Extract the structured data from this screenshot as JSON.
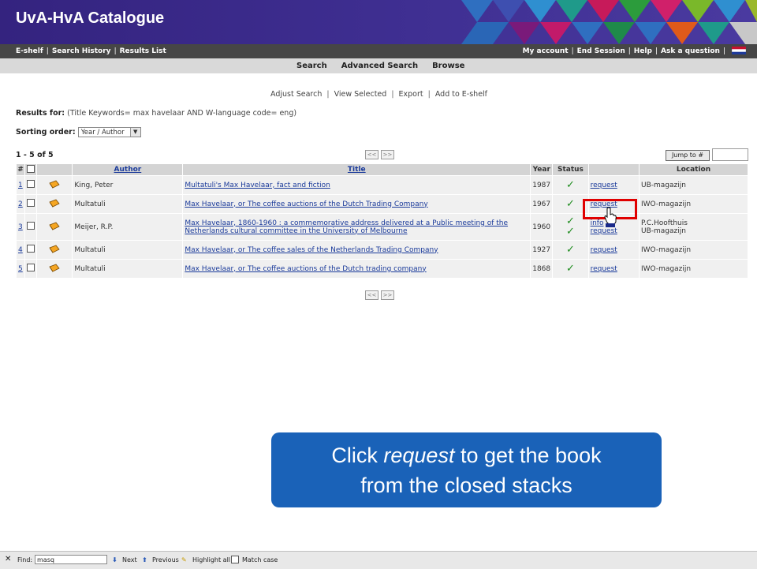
{
  "header": {
    "title": "UvA-HvA Catalogue"
  },
  "topbar": {
    "left": [
      "E-shelf",
      "Search History",
      "Results List"
    ],
    "right": [
      "My account",
      "End Session",
      "Help",
      "Ask a question"
    ],
    "separator": "|"
  },
  "mainnav": [
    "Search",
    "Advanced Search",
    "Browse"
  ],
  "actions": [
    "Adjust Search",
    "View Selected",
    "Export",
    "Add to E-shelf"
  ],
  "results_for": {
    "label": "Results for:",
    "query": "(Title Keywords= max havelaar AND W-language code= eng)"
  },
  "sorting": {
    "label": "Sorting order:",
    "value": "Year / Author"
  },
  "range": "1 - 5 of 5",
  "pager": {
    "prev": "<<",
    "next": ">>"
  },
  "jump": {
    "label": "Jump to #"
  },
  "table": {
    "headers": {
      "num": "#",
      "author": "Author",
      "title": "Title",
      "year": "Year",
      "status": "Status",
      "location": "Location"
    },
    "rows": [
      {
        "num": "1",
        "author": "King, Peter",
        "title": "Multatuli's Max Havelaar, fact and fiction",
        "year": "1987",
        "actions": [
          "request"
        ],
        "locations": [
          "UB-magazijn"
        ]
      },
      {
        "num": "2",
        "author": "Multatuli",
        "title": "Max Havelaar, or The coffee auctions of the Dutch Trading Company",
        "year": "1967",
        "actions": [
          "request"
        ],
        "locations": [
          "IWO-magazijn"
        ]
      },
      {
        "num": "3",
        "author": "Meijer, R.P.",
        "title": "Max Havelaar, 1860-1960 : a commemorative address delivered at a Public meeting of the",
        "title2": "Netherlands cultural committee in the University of Melbourne",
        "year": "1960",
        "actions": [
          "info",
          "request"
        ],
        "locations": [
          "P.C.Hoofthuis",
          "UB-magazijn"
        ]
      },
      {
        "num": "4",
        "author": "Multatuli",
        "title": "Max Havelaar, or The coffee sales of the Netherlands Trading Company",
        "year": "1927",
        "actions": [
          "request"
        ],
        "locations": [
          "IWO-magazijn"
        ]
      },
      {
        "num": "5",
        "author": "Multatuli",
        "title": "Max Havelaar, or The coffee auctions of the Dutch trading company",
        "year": "1868",
        "actions": [
          "request"
        ],
        "locations": [
          "IWO-magazijn"
        ]
      }
    ],
    "status_glyph": "✓"
  },
  "callout": {
    "line1_pre": "Click ",
    "line1_em": "request",
    "line1_post": " to get the book",
    "line2": "from the closed stacks"
  },
  "findbar": {
    "close": "✕",
    "label": "Find:",
    "value": "masq",
    "next": "Next",
    "previous": "Previous",
    "highlight": "Highlight all",
    "match_case": "Match case"
  },
  "colors": {
    "banner_purple": "#3b2a8c",
    "callout_blue": "#1a62b8",
    "highlight_red": "#e00000",
    "check_green": "#1e8c1e"
  }
}
